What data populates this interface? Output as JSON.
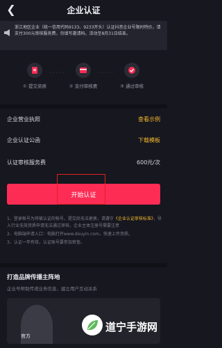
{
  "header": {
    "title": "企业认证",
    "back_icon": "chevron-left-icon"
  },
  "notice": {
    "icon": "megaphone-icon",
    "text": "浙江地区企业（统一信用代码9133、9233开头）认证抖音企业号限时特价，请支付300元审核服务费，勿填写邀请码。活动至8月31日结束。"
  },
  "steps": [
    {
      "label": "① 提交资质",
      "icon": "upload-doc-icon"
    },
    {
      "label": "② 支付审核费",
      "icon": "payment-icon"
    },
    {
      "label": "③ 通过审核",
      "icon": "verified-badge-icon"
    }
  ],
  "rows": [
    {
      "label": "企业营业执照",
      "value": "查看示例"
    },
    {
      "label": "企业认证公函",
      "value": "下载模板"
    },
    {
      "label": "认证审核服务费",
      "value": "600元/次"
    }
  ],
  "cta": {
    "label": "开始认证"
  },
  "notes": {
    "n1_a": "1、登录帐号为将被认证的帐号，提交后无法更换，请遵守",
    "n1_link": "《企业认证审核标准》",
    "n1_b": "，导入行业无效资质申请无法通过审核，企业主体注册号需要注意",
    "n2": "2、电脑端申请入口：电脑打开www.douyin.com，快速上传资质。",
    "n3": "3、认证一年有效，认证账号要参加审查。"
  },
  "brand": {
    "title": "打造品牌传播主阵地",
    "subtitle": "企业号帮助传递业务信息，建立用户互动关系",
    "card_label": "官方"
  },
  "watermark": {
    "text": "道宁手游网"
  }
}
